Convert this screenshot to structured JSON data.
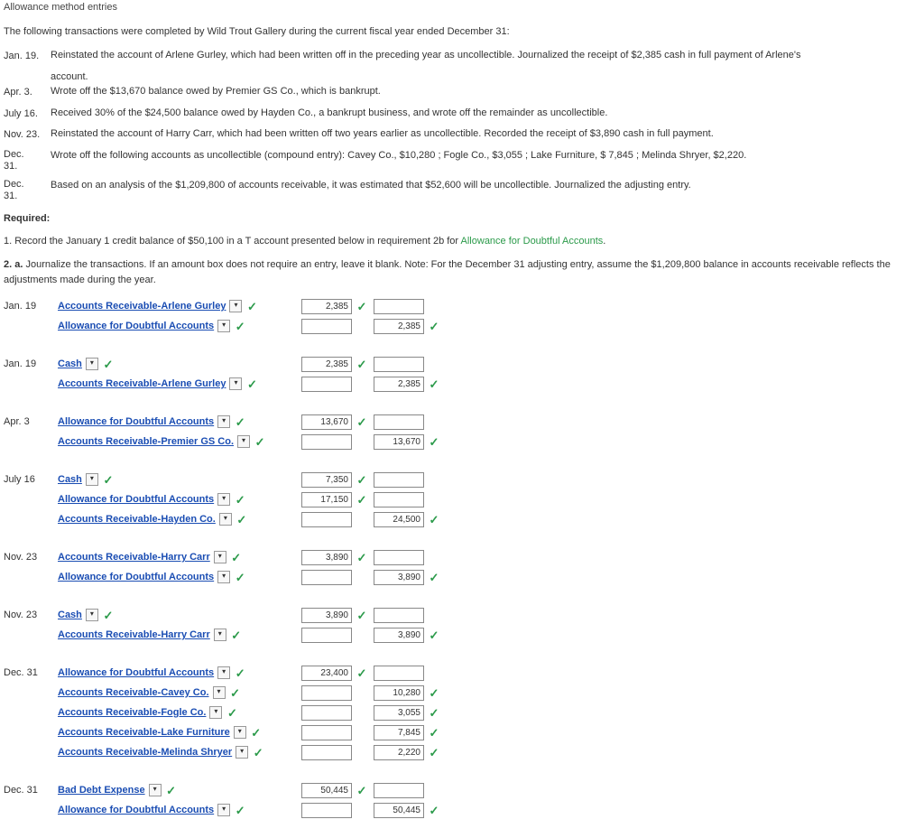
{
  "heading": "Allowance method entries",
  "intro": "The following transactions were completed by Wild Trout Gallery during the current fiscal year ended December 31:",
  "transactions": [
    {
      "date": "Jan. 19.",
      "text": "Reinstated the account of Arlene Gurley, which had been written off in the preceding year as uncollectible. Journalized the receipt of $2,385 cash in full payment of Arlene's",
      "cont": "account."
    },
    {
      "date": "Apr. 3.",
      "text": "Wrote off the $13,670 balance owed by Premier GS Co., which is bankrupt."
    },
    {
      "date": "July 16.",
      "text": "Received 30% of the $24,500 balance owed by Hayden Co., a bankrupt business, and wrote off the remainder as uncollectible."
    },
    {
      "date": "Nov. 23.",
      "text": "Reinstated the account of Harry Carr, which had been written off two years earlier as uncollectible. Recorded the receipt of $3,890 cash in full payment."
    },
    {
      "date": "Dec. 31.",
      "tall": true,
      "text": "Wrote off the following accounts as uncollectible (compound entry): Cavey Co., $10,280 ; Fogle Co., $3,055 ; Lake Furniture, $ 7,845 ; Melinda Shryer, $2,220."
    },
    {
      "date": "Dec. 31.",
      "tall": true,
      "text": "Based on an analysis of the $1,209,800 of accounts receivable, it was estimated that $52,600 will be uncollectible. Journalized the adjusting entry."
    }
  ],
  "required_label": "Required:",
  "req1_pre": "1. Record the January 1 credit balance of $50,100 in a T account presented below in requirement 2b for ",
  "req1_link": "Allowance for Doubtful Accounts",
  "req1_post": ".",
  "req2a_label": "2. a.",
  "req2a_text": " Journalize the transactions. If an amount box does not require an entry, leave it blank. Note: For the December 31 adjusting entry, assume the $1,209,800 balance in accounts receivable reflects the adjustments made during the year.",
  "journal": [
    {
      "date": "Jan. 19",
      "rows": [
        {
          "acct": "Accounts Receivable-Arlene Gurley",
          "debit": "2,385",
          "credit": ""
        },
        {
          "acct": "Allowance for Doubtful Accounts",
          "debit": "",
          "credit": "2,385"
        }
      ]
    },
    {
      "date": "Jan. 19",
      "rows": [
        {
          "acct": "Cash",
          "debit": "2,385",
          "credit": ""
        },
        {
          "acct": "Accounts Receivable-Arlene Gurley",
          "debit": "",
          "credit": "2,385"
        }
      ]
    },
    {
      "date": "Apr. 3",
      "rows": [
        {
          "acct": "Allowance for Doubtful Accounts",
          "debit": "13,670",
          "credit": ""
        },
        {
          "acct": "Accounts Receivable-Premier GS Co.",
          "debit": "",
          "credit": "13,670"
        }
      ]
    },
    {
      "date": "July 16",
      "rows": [
        {
          "acct": "Cash",
          "debit": "7,350",
          "credit": ""
        },
        {
          "acct": "Allowance for Doubtful Accounts",
          "debit": "17,150",
          "credit": ""
        },
        {
          "acct": "Accounts Receivable-Hayden Co.",
          "debit": "",
          "credit": "24,500"
        }
      ]
    },
    {
      "date": "Nov. 23",
      "rows": [
        {
          "acct": "Accounts Receivable-Harry Carr",
          "debit": "3,890",
          "credit": ""
        },
        {
          "acct": "Allowance for Doubtful Accounts",
          "debit": "",
          "credit": "3,890"
        }
      ]
    },
    {
      "date": "Nov. 23",
      "rows": [
        {
          "acct": "Cash",
          "debit": "3,890",
          "credit": ""
        },
        {
          "acct": "Accounts Receivable-Harry Carr",
          "debit": "",
          "credit": "3,890"
        }
      ]
    },
    {
      "date": "Dec. 31",
      "rows": [
        {
          "acct": "Allowance for Doubtful Accounts",
          "debit": "23,400",
          "credit": ""
        },
        {
          "acct": "Accounts Receivable-Cavey Co.",
          "debit": "",
          "credit": "10,280"
        },
        {
          "acct": "Accounts Receivable-Fogle Co.",
          "debit": "",
          "credit": "3,055"
        },
        {
          "acct": "Accounts Receivable-Lake Furniture",
          "debit": "",
          "credit": "7,845"
        },
        {
          "acct": "Accounts Receivable-Melinda Shryer",
          "debit": "",
          "credit": "2,220"
        }
      ]
    },
    {
      "date": "Dec. 31",
      "rows": [
        {
          "acct": "Bad Debt Expense",
          "debit": "50,445",
          "credit": ""
        },
        {
          "acct": "Allowance for Doubtful Accounts",
          "debit": "",
          "credit": "50,445"
        }
      ]
    }
  ]
}
